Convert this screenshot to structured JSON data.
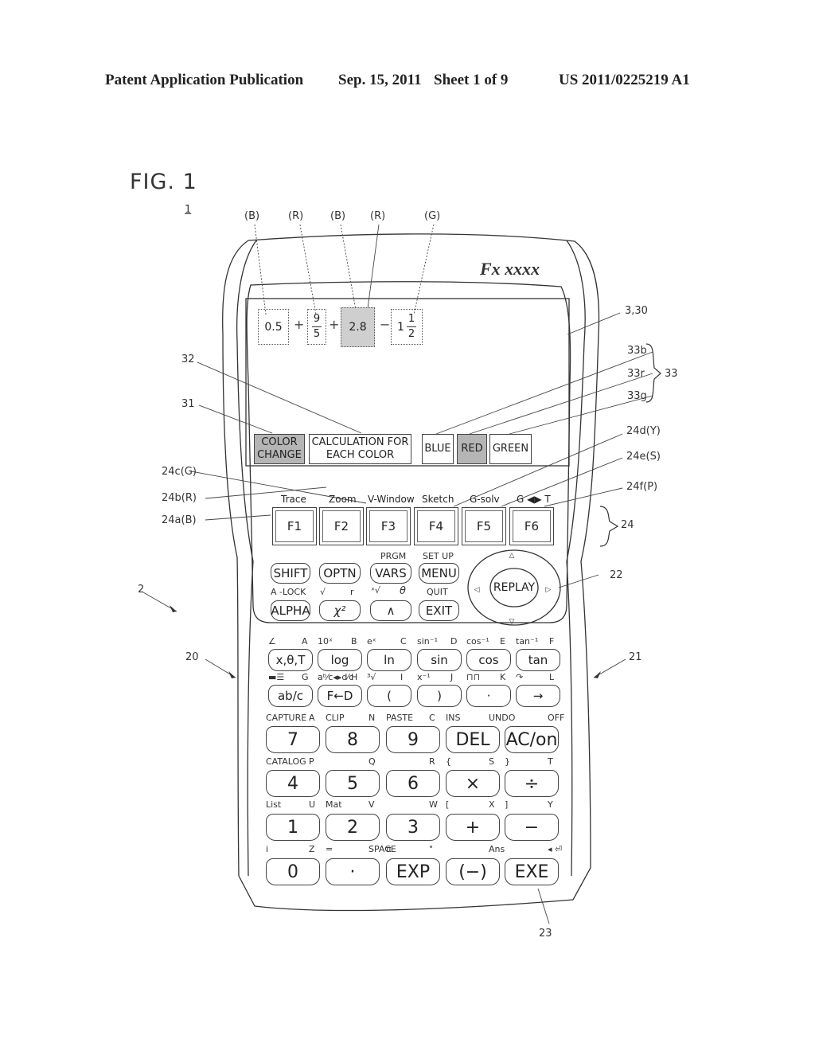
{
  "header": {
    "left": "Patent Application Publication",
    "date": "Sep. 15, 2011",
    "sheet": "Sheet 1 of 9",
    "number": "US 2011/0225219 A1"
  },
  "figure": {
    "title": "FIG. 1",
    "ref_main": "1",
    "brand": "Fx  xxxx"
  },
  "color_tags": [
    "(B)",
    "(R)",
    "(B)",
    "(R)",
    "(G)"
  ],
  "expression": {
    "term1": "0.5",
    "op1": "+",
    "term2_num": "9",
    "term2_den": "5",
    "op2": "+",
    "term3": "2.8",
    "op3": "−",
    "term4_whole": "1",
    "term4_num": "1",
    "term4_den": "2"
  },
  "screen_buttons": {
    "color_change": "COLOR CHANGE",
    "calc_each_color": "CALCULATION FOR EACH COLOR",
    "blue": "BLUE",
    "red": "RED",
    "green": "GREEN"
  },
  "ref_labels": {
    "screen": "3,30",
    "r32": "32",
    "r31": "31",
    "r33b": "33b",
    "r33r": "33r",
    "r33g": "33g",
    "r33": "33",
    "r24d": "24d(Y)",
    "r24e": "24e(S)",
    "r24c": "24c(G)",
    "r24f": "24f(P)",
    "r24b": "24b(R)",
    "r24a": "24a(B)",
    "r24": "24",
    "r22": "22",
    "r2": "2",
    "r20": "20",
    "r21": "21",
    "r23": "23"
  },
  "function_keys": [
    {
      "label": "F1",
      "above": "Trace"
    },
    {
      "label": "F2",
      "above": "Zoom"
    },
    {
      "label": "F3",
      "above": "V-Window"
    },
    {
      "label": "F4",
      "above": "Sketch"
    },
    {
      "label": "F5",
      "above": "G-solv"
    },
    {
      "label": "F6",
      "above": "G ◀▶ T"
    }
  ],
  "control_keys": {
    "row1": [
      {
        "label": "SHIFT",
        "above": ""
      },
      {
        "label": "OPTN",
        "above": ""
      },
      {
        "label": "VARS",
        "above": "PRGM"
      },
      {
        "label": "MENU",
        "above": "SET UP"
      }
    ],
    "row2": [
      {
        "label": "ALPHA",
        "above": "A -LOCK"
      },
      {
        "label": "χ²",
        "above_left": "√",
        "above_right": "r"
      },
      {
        "label": "∧",
        "above_left": "ˣ√",
        "above_right": "θ"
      },
      {
        "label": "EXIT",
        "above": "QUIT"
      }
    ],
    "replay": "REPLAY"
  },
  "sci_keys": {
    "row1": [
      {
        "label": "x,θ,T",
        "left": "∠",
        "right": "A"
      },
      {
        "label": "log",
        "left": "10ˣ",
        "right": "B"
      },
      {
        "label": "ln",
        "left": "eˣ",
        "right": "C"
      },
      {
        "label": "sin",
        "left": "sin⁻¹",
        "right": "D"
      },
      {
        "label": "cos",
        "left": "cos⁻¹",
        "right": "E"
      },
      {
        "label": "tan",
        "left": "tan⁻¹",
        "right": "F"
      }
    ],
    "row2": [
      {
        "label": "ab/c",
        "left": "▬☰",
        "right": "G"
      },
      {
        "label": "F←D",
        "left": "aᵇ⁄c◂▸d⁄c",
        "right": "H"
      },
      {
        "label": "(",
        "left": "³√",
        "right": "I"
      },
      {
        "label": ")",
        "left": "x⁻¹",
        "right": "J"
      },
      {
        "label": "·",
        "left": "⊓⊓",
        "right": "K"
      },
      {
        "label": "→",
        "left": "↷",
        "right": "L"
      }
    ]
  },
  "num_keys": {
    "row1": [
      {
        "label": "7",
        "left": "CAPTURE",
        "right": "A"
      },
      {
        "label": "8",
        "left": "CLIP",
        "right": "N"
      },
      {
        "label": "9",
        "left": "PASTE",
        "right": "C"
      },
      {
        "label": "DEL",
        "left": "INS",
        "right": "UNDO"
      },
      {
        "label": "AC/on",
        "left": "",
        "right": "OFF"
      }
    ],
    "row2": [
      {
        "label": "4",
        "left": "CATALOG",
        "right": "P"
      },
      {
        "label": "5",
        "left": "",
        "right": "Q"
      },
      {
        "label": "6",
        "left": "",
        "right": "R"
      },
      {
        "label": "×",
        "left": "{",
        "right": "S"
      },
      {
        "label": "÷",
        "left": "}",
        "right": "T"
      }
    ],
    "row3": [
      {
        "label": "1",
        "left": "List",
        "right": "U"
      },
      {
        "label": "2",
        "left": "Mat",
        "right": "V"
      },
      {
        "label": "3",
        "left": "",
        "right": "W"
      },
      {
        "label": "+",
        "left": "[",
        "right": "X"
      },
      {
        "label": "−",
        "left": "]",
        "right": "Y"
      }
    ],
    "row4": [
      {
        "label": "0",
        "left": "i",
        "right": "Z"
      },
      {
        "label": "·",
        "left": "=",
        "right": "SPACE"
      },
      {
        "label": "EXP",
        "left": "π",
        "right": "\""
      },
      {
        "label": "(−)",
        "left": "",
        "right": "Ans"
      },
      {
        "label": "EXE",
        "left": "",
        "right": "◂ ⏎"
      }
    ]
  }
}
